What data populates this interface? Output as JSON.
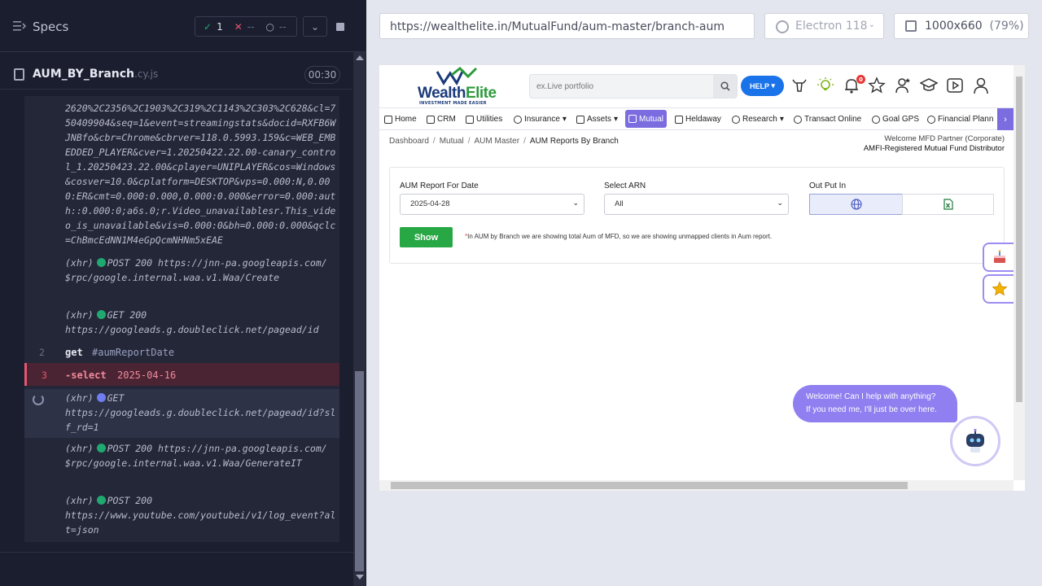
{
  "reporter": {
    "specs_label": "Specs",
    "stats": {
      "passed": "1",
      "failed": "--",
      "pending": "--"
    },
    "spec_name": "AUM_BY_Branch",
    "spec_ext": ".cy.js",
    "spec_time": "00:30",
    "log_top": "2620%2C2356%2C1903%2C319%2C1143%2C303%2C628&cl=750409904&seq=1&event=streamingstats&docid=RXFB6WJNBfo&cbr=Chrome&cbrver=118.0.5993.159&c=WEB_EMBEDDED_PLAYER&cver=1.20250422.22.00-canary_control_1.20250423.22.00&cplayer=UNIPLAYER&cos=Windows&cosver=10.0&cplatform=DESKTOP&vps=0.000:N,0.000:ER&cmt=0.000:0.000,0.000:0.000&error=0.000:auth::0.000:0;a6s.0;r.Video_unavailablesr.This_video_is_unavailable&vis=0.000:0&bh=0.000:0.000&qclc=ChBmcEdNN1M4eGpQcmNHNm5xEAE",
    "xhr1": {
      "prefix": "(xhr)",
      "method": "POST 200",
      "url": "https://jnn-pa.googleapis.com/$rpc/google.internal.waa.v1.Waa/Create"
    },
    "xhr2": {
      "prefix": "(xhr)",
      "method": "GET 200",
      "url": "https://googleads.g.doubleclick.net/pagead/id"
    },
    "cmd2": {
      "num": "2",
      "name": "get",
      "arg": "#aumReportDate"
    },
    "cmd3": {
      "num": "3",
      "name": "-select",
      "arg": "2025-04-16"
    },
    "xhr3": {
      "prefix": "(xhr)",
      "method": "GET",
      "url": "https://googleads.g.doubleclick.net/pagead/id?slf_rd=1"
    },
    "xhr4": {
      "prefix": "(xhr)",
      "method": "POST 200",
      "url": "https://jnn-pa.googleapis.com/$rpc/google.internal.waa.v1.Waa/GenerateIT"
    },
    "xhr5": {
      "prefix": "(xhr)",
      "method": "POST 200",
      "url": "https://www.youtube.com/youtubei/v1/log_event?alt=json"
    }
  },
  "runner": {
    "url": "https://wealthelite.in/MutualFund/aum-master/branch-aum",
    "browser": "Electron 118",
    "viewport": "1000x660",
    "viewport_pct": "(79%)"
  },
  "app": {
    "logo": {
      "part1": "Wealth",
      "part2": "Elite",
      "tagline": "INVESTMENT MADE EASIER"
    },
    "search_placeholder": "ex.Live portfolio",
    "help_label": "HELP",
    "bell_count": "0",
    "nav": [
      "Home",
      "CRM",
      "Utilities",
      "Insurance",
      "Assets",
      "Mutual",
      "Heldaway",
      "Research",
      "Transact Online",
      "Goal GPS",
      "Financial Plann"
    ],
    "breadcrumb": [
      "Dashboard",
      "Mutual",
      "AUM Master",
      "AUM Reports By Branch"
    ],
    "welcome_line1": "Welcome MFD Partner (Corporate)",
    "welcome_line2": "AMFI-Registered Mutual Fund Distributor",
    "form": {
      "date_label": "AUM Report For Date",
      "date_value": "2025-04-28",
      "arn_label": "Select ARN",
      "arn_value": "All",
      "output_label": "Out Put In",
      "show_label": "Show",
      "note": "In AUM by Branch we are showing total Aum of MFD, so we are showing unmapped clients in Aum report."
    },
    "chat_line1": "Welcome! Can I help with anything?",
    "chat_line2": "If you need me, I'll just be over here."
  },
  "colors": {
    "accent": "#7b6ce0",
    "pass": "#1fa971",
    "fail": "#e45770",
    "show": "#28a745",
    "help": "#1a73e8"
  }
}
